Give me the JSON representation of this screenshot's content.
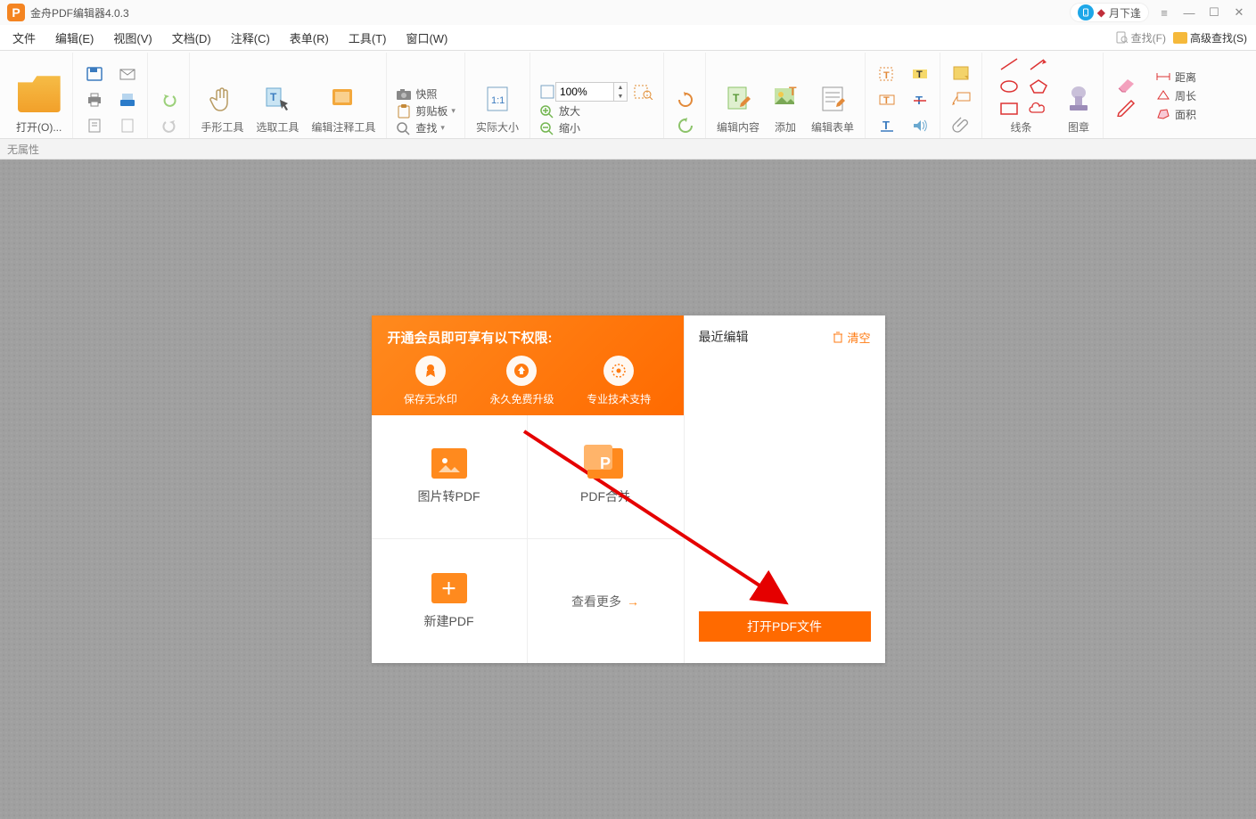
{
  "title": {
    "app": "金舟PDF编辑器4.0.3",
    "user": "月下逢"
  },
  "menu": {
    "file": "文件",
    "edit": "编辑(E)",
    "view": "视图(V)",
    "doc": "文档(D)",
    "annot": "注释(C)",
    "form": "表单(R)",
    "tool": "工具(T)",
    "window": "窗口(W)",
    "find": "查找(F)",
    "advfind": "高级查找(S)"
  },
  "toolbar": {
    "open": "打开(O)...",
    "hand": "手形工具",
    "select": "选取工具",
    "editannot": "编辑注释工具",
    "snapshot": "快照",
    "clipboard": "剪贴板",
    "findbtn": "查找",
    "actual": "实际大小",
    "zoom_val": "100%",
    "zoom_in": "放大",
    "zoom_out": "缩小",
    "editcontent": "编辑内容",
    "add": "添加",
    "editform": "编辑表单",
    "lines": "线条",
    "stamp": "图章",
    "distance": "距离",
    "perimeter": "周长",
    "area": "面积"
  },
  "prop": "无属性",
  "start": {
    "vip_title": "开通会员即可享有以下权限:",
    "vip1": "保存无水印",
    "vip2": "永久免费升级",
    "vip3": "专业技术支持",
    "tile1": "图片转PDF",
    "tile2": "PDF合并",
    "tile3": "新建PDF",
    "tile4": "查看更多",
    "recent": "最近编辑",
    "clear": "清空",
    "openbtn": "打开PDF文件"
  }
}
